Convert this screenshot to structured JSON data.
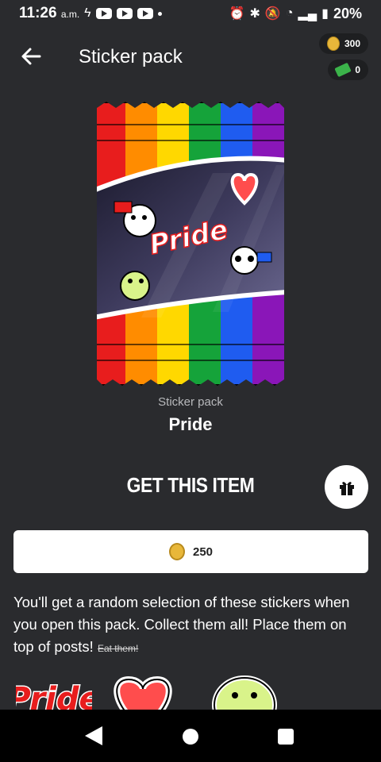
{
  "status_bar": {
    "time": "11:26",
    "time_suffix": "a.m.",
    "battery": "20%"
  },
  "header": {
    "title": "Sticker pack",
    "coins": "300",
    "cash": "0"
  },
  "pack": {
    "type_label": "Sticker pack",
    "name": "Pride",
    "art_text": "Pride"
  },
  "purchase": {
    "heading": "GET THIS ITEM",
    "price": "250"
  },
  "description": {
    "text": "You'll get a random selection of these stickers when you open this pack. Collect them all! Place them on top of posts!",
    "strike": "Eat them!"
  },
  "colors": {
    "background": "#2a2b2e",
    "coin": "#e8b73a",
    "cash": "#3bb34a"
  },
  "icons": [
    "back-arrow-icon",
    "coin-icon",
    "cash-icon",
    "gift-icon",
    "alarm-icon",
    "bluetooth-icon",
    "mute-icon",
    "wifi-icon",
    "signal-icon",
    "battery-icon"
  ]
}
